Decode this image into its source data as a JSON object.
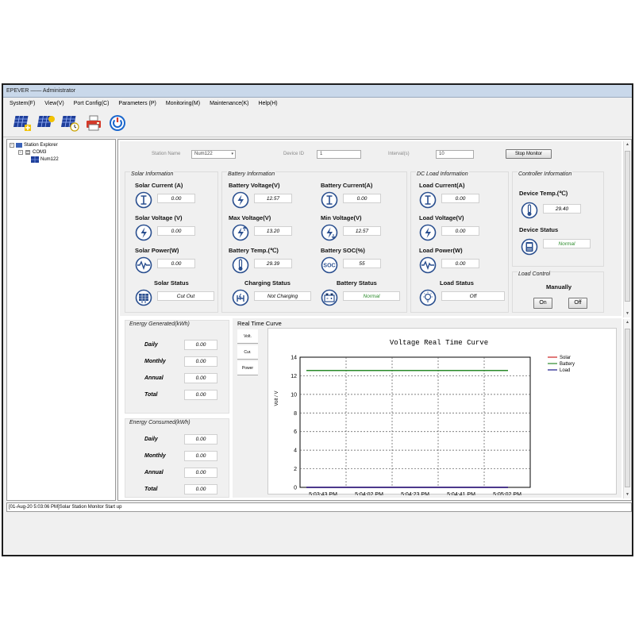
{
  "window": {
    "title": "EPEVER —— Administrator"
  },
  "menu": [
    "System(F)",
    "View(V)",
    "Port Config(C)",
    "Parameters (P)",
    "Monitoring(M)",
    "Maintenance(K)",
    "Help(H)"
  ],
  "tree": {
    "root": "Station Explorer",
    "port": "COM3",
    "station": "Num122"
  },
  "controls": {
    "station_name_label": "Station Name",
    "station_name_value": "Num122",
    "device_id_label": "Device ID",
    "device_id_value": "1",
    "interval_label": "Interval(s)",
    "interval_value": "10",
    "stop_button": "Stop Monitor"
  },
  "solar": {
    "title": "Solar Information",
    "current_label": "Solar Current (A)",
    "current": "0.00",
    "voltage_label": "Solar Voltage (V)",
    "voltage": "0.00",
    "power_label": "Solar Power(W)",
    "power": "0.00",
    "status_label": "Solar Status",
    "status": "Cut Out"
  },
  "battery": {
    "title": "Battery Information",
    "voltage_label": "Battery Voltage(V)",
    "voltage": "12.57",
    "current_label": "Battery Current(A)",
    "current": "0.00",
    "max_voltage_label": "Max Voltage(V)",
    "max_voltage": "13.20",
    "min_voltage_label": "Min Voltage(V)",
    "min_voltage": "12.57",
    "temp_label": "Battery Temp.(℃)",
    "temp": "29.39",
    "soc_label": "Battery SOC(%)",
    "soc": "55",
    "soc_icon_text": "SOC",
    "charging_label": "Charging Status",
    "charging": "Not Charging",
    "status_label": "Battery Status",
    "status": "Normal"
  },
  "load": {
    "title": "DC Load Information",
    "current_label": "Load Current(A)",
    "current": "0.00",
    "voltage_label": "Load Voltage(V)",
    "voltage": "0.00",
    "power_label": "Load Power(W)",
    "power": "0.00",
    "status_label": "Load Status",
    "status": "Off"
  },
  "controller": {
    "title": "Controller Information",
    "temp_label": "Device Temp.(℃)",
    "temp": "29.40",
    "status_label": "Device Status",
    "status": "Normal"
  },
  "load_control": {
    "title": "Load Control",
    "mode": "Manually",
    "on": "On",
    "off": "Off"
  },
  "energy_generated": {
    "title": "Energy Generated(kWh)",
    "daily_label": "Daily",
    "daily": "0.00",
    "monthly_label": "Monthly",
    "monthly": "0.00",
    "annual_label": "Annual",
    "annual": "0.00",
    "total_label": "Total",
    "total": "0.00"
  },
  "energy_consumed": {
    "title": "Energy Consumed(kWh)",
    "daily_label": "Daily",
    "daily": "0.00",
    "monthly_label": "Monthly",
    "monthly": "0.00",
    "annual_label": "Annual",
    "annual": "0.00",
    "total_label": "Total",
    "total": "0.00"
  },
  "curve": {
    "title": "Real Time Curve",
    "tabs": [
      "Volt.",
      "Cur.",
      "Power"
    ]
  },
  "chart_data": {
    "type": "line",
    "title": "Voltage Real Time Curve",
    "ylabel": "Volt / V",
    "xlabel": "",
    "ylim": [
      0,
      14
    ],
    "yticks": [
      0,
      2,
      4,
      6,
      8,
      10,
      12,
      14
    ],
    "x_ticks": [
      "5:03:43 PM",
      "5:04:02 PM",
      "5:04:23 PM",
      "5:04:41 PM",
      "5:05:02 PM"
    ],
    "grid": true,
    "legend": "top-right",
    "series": [
      {
        "name": "Solar",
        "color": "#cc2222",
        "values": [
          0,
          0,
          0,
          0,
          0
        ]
      },
      {
        "name": "Battery",
        "color": "#2a8a2a",
        "values": [
          12.57,
          12.57,
          12.57,
          12.57,
          12.57
        ]
      },
      {
        "name": "Load",
        "color": "#1a1a8a",
        "values": [
          0,
          0,
          0,
          0,
          0
        ]
      }
    ]
  },
  "status_log": "[01-Aug-20 5:03:06 PM]Solar Station Monitor Start up"
}
